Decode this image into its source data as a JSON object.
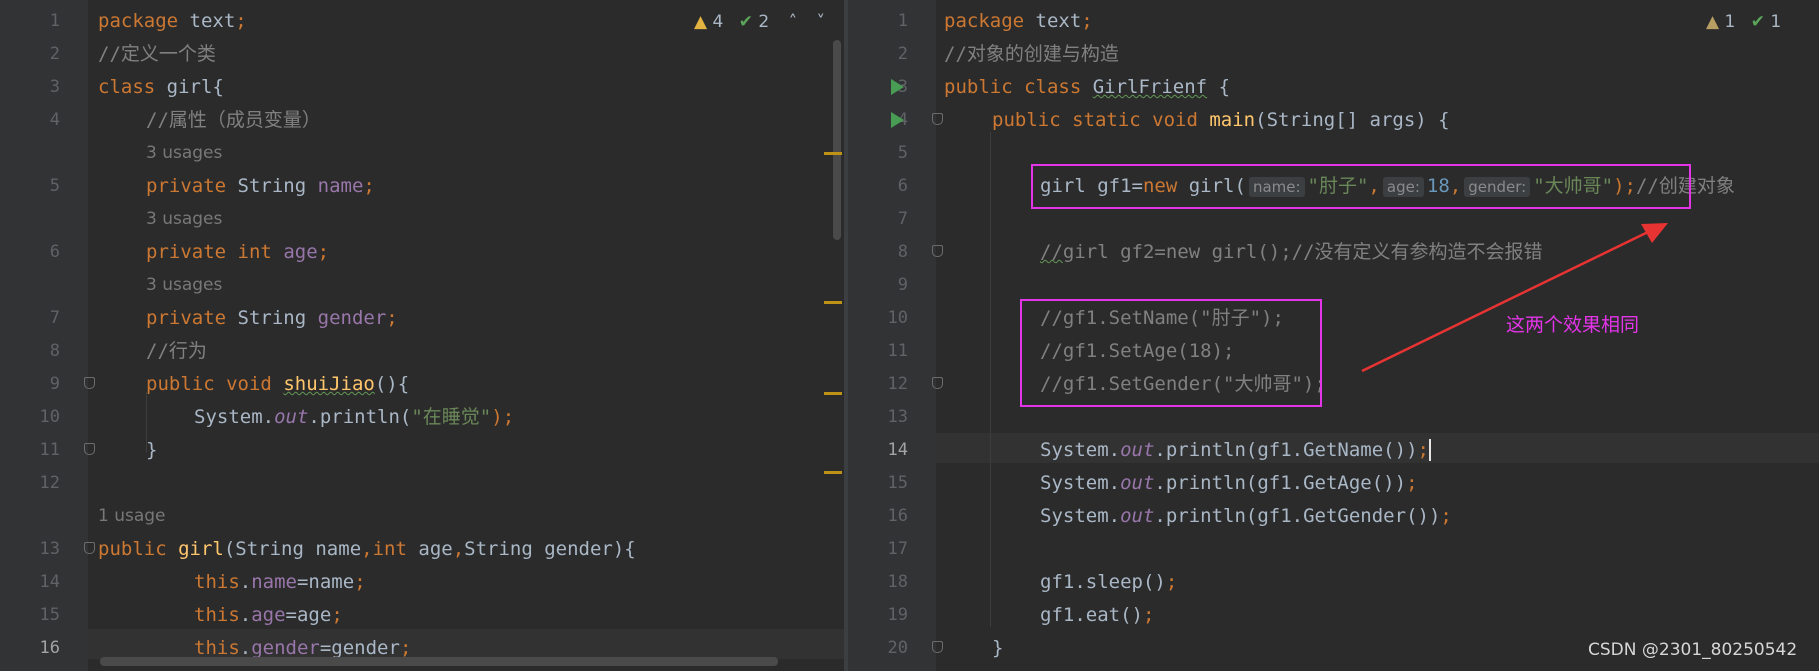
{
  "left_editor": {
    "inspections": {
      "warnings": "4",
      "weak_warnings": "2"
    },
    "line_numbers": [
      "1",
      "2",
      "3",
      "4",
      "5",
      "6",
      "7",
      "8",
      "9",
      "10",
      "11",
      "12",
      "13",
      "14",
      "15",
      "16"
    ],
    "usage_hints": [
      "3 usages",
      "3 usages",
      "3 usages",
      "1 usage"
    ],
    "code": {
      "l1": [
        "package",
        "text",
        ";"
      ],
      "l2": "//定义一个类",
      "l3": [
        "class",
        "girl{"
      ],
      "l4": "//属性（成员变量）",
      "l5": [
        "private",
        "String",
        "name",
        ";"
      ],
      "l6": [
        "private",
        "int",
        "age",
        ";"
      ],
      "l7": [
        "private",
        "String",
        "gender",
        ";"
      ],
      "l8": "//行为",
      "l9": [
        "public",
        "void",
        "shuiJiao",
        "(){"
      ],
      "l10": [
        "System.",
        "out",
        ".println(",
        "\"在睡觉\"",
        ");"
      ],
      "l11": "}",
      "l13": [
        "public",
        "girl",
        "(String name",
        ",",
        "int",
        "age",
        ",",
        "String gender){"
      ],
      "l14": [
        "this",
        ".",
        "name",
        "=name",
        ";"
      ],
      "l15": [
        "this",
        ".",
        "age",
        "=age",
        ";"
      ],
      "l16": [
        "this",
        ".",
        "gender",
        "=gender",
        ";"
      ]
    }
  },
  "right_editor": {
    "inspections": {
      "warnings": "1",
      "weak_warnings": "1"
    },
    "line_numbers": [
      "1",
      "2",
      "3",
      "4",
      "5",
      "6",
      "7",
      "8",
      "9",
      "10",
      "11",
      "12",
      "13",
      "14",
      "15",
      "16",
      "17",
      "18",
      "19",
      "20"
    ],
    "code": {
      "l1": [
        "package",
        "text",
        ";"
      ],
      "l2": "//对象的创建与构造",
      "l3": [
        "public class",
        "GirlFrienf",
        "{"
      ],
      "l4": [
        "public static void",
        "main",
        "(String[] args) {"
      ],
      "l6": [
        "girl gf1=",
        "new",
        "girl(",
        "name:",
        "\"肘子\"",
        ",",
        "age:",
        "18",
        ",",
        "gender:",
        "\"大帅哥\"",
        ");",
        "//创建对象"
      ],
      "l8": [
        "//",
        "girl gf2=new girl();//没有定义有参构造不会报错"
      ],
      "l10": "//gf1.SetName(\"肘子\");",
      "l11": "//gf1.SetAge(18);",
      "l12": "//gf1.SetGender(\"大帅哥\");",
      "l14": [
        "System.",
        "out",
        ".println(gf1.GetName())",
        ";"
      ],
      "l15": [
        "System.",
        "out",
        ".println(gf1.GetAge())",
        ";"
      ],
      "l16": [
        "System.",
        "out",
        ".println(gf1.GetGender())",
        ";"
      ],
      "l18": [
        "gf1.sleep()",
        ";"
      ],
      "l19": [
        "gf1.eat()",
        ";"
      ],
      "l20": "}"
    }
  },
  "annotation": {
    "text": "这两个效果相同",
    "color": "#e334e8"
  },
  "watermark": "CSDN @2301_80250542",
  "icons": {
    "warning": "warning-triangle-icon",
    "check": "double-check-icon",
    "run": "run-triangle-icon"
  },
  "colors": {
    "keyword": "#cc7832",
    "field": "#9876aa",
    "string": "#6a8759",
    "number": "#6897bb",
    "comment": "#808080",
    "method": "#ffc66d",
    "text": "#a9b7c6",
    "background": "#2b2b2b"
  }
}
